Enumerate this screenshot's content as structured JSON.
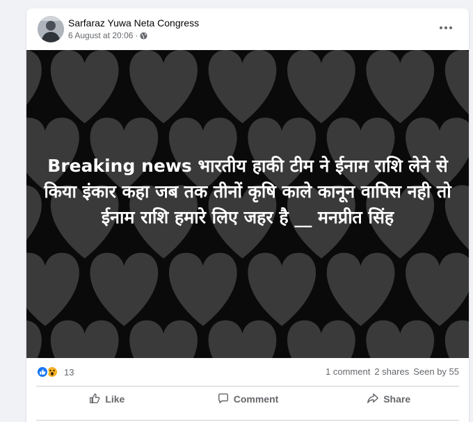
{
  "post": {
    "author": "Sarfaraz Yuwa Neta Congress",
    "timestamp": "6 August at 20:06",
    "separator": "·",
    "privacy_icon": "globe-icon",
    "caption": "Breaking news भारतीय हाकी टीम ने ईनाम राशि लेने से किया इंकार कहा जब तक तीनों कृषि काले कानून वापिस नही तो ईनाम राशि हमारे लिए जहर है __ मनप्रीत सिंह"
  },
  "stats": {
    "reaction_icons": [
      "like-reaction-icon",
      "wow-reaction-icon"
    ],
    "reaction_count": "13",
    "comments": "1 comment",
    "shares": "2 shares",
    "seen": "Seen by 55"
  },
  "actions": {
    "like": "Like",
    "comment": "Comment",
    "share": "Share"
  },
  "colors": {
    "background": "#f0f2f5",
    "card": "#ffffff",
    "media_bg": "#0a0a0a",
    "heart": "#3a3a3a",
    "secondary_text": "#65676b",
    "like_blue": "#1877f2",
    "wow_yellow": "#f7b125"
  }
}
